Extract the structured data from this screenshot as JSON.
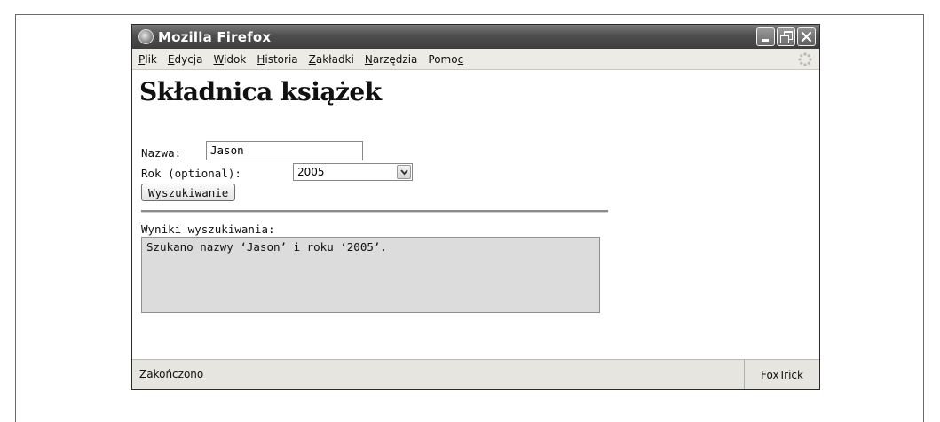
{
  "window": {
    "title": "Mozilla Firefox"
  },
  "menubar": {
    "items": [
      {
        "first": "P",
        "rest": "lik"
      },
      {
        "first": "E",
        "rest": "dycja"
      },
      {
        "first": "W",
        "rest": "idok"
      },
      {
        "first": "H",
        "rest": "istoria"
      },
      {
        "first": "Z",
        "rest": "akładki"
      },
      {
        "first": "N",
        "rest": "arzędzia"
      },
      {
        "pre": "Pomo",
        "ul": "c"
      }
    ]
  },
  "page": {
    "title": "Składnica książek",
    "name_label": "Nazwa:",
    "name_value": "Jason",
    "year_label": "Rok (optional):",
    "year_value": "2005",
    "search_button": "Wyszukiwanie",
    "results_label": "Wyniki wyszukiwania:",
    "results_text": "Szukano nazwy ‘Jason’ i roku ‘2005’."
  },
  "statusbar": {
    "status": "Zakończono",
    "extension": "FoxTrick"
  },
  "icons": {
    "app": "firefox-icon",
    "minimize": "minimize-icon",
    "maximize": "maximize-icon",
    "close": "close-icon",
    "throbber": "throbber-icon",
    "dropdown": "chevron-down-icon"
  }
}
